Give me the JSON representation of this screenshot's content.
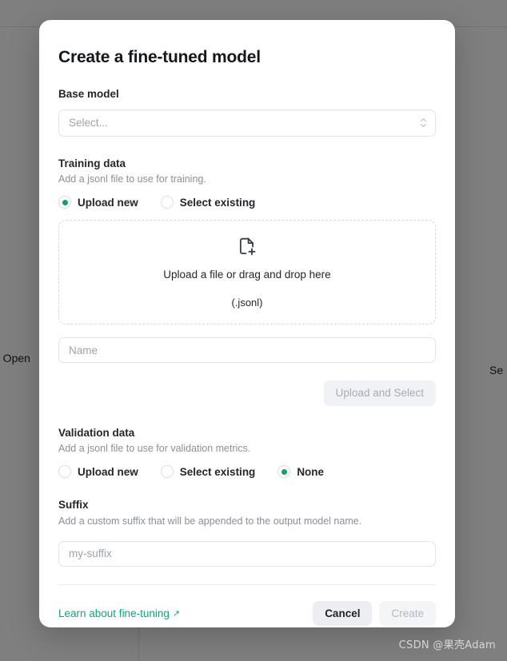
{
  "background": {
    "left_text": "e Open",
    "right_text": "Se"
  },
  "modal": {
    "title": "Create a fine-tuned model",
    "base_model": {
      "label": "Base model",
      "select_placeholder": "Select...",
      "chevron_icon": "chevron-up-down-icon"
    },
    "training_data": {
      "label": "Training data",
      "description": "Add a jsonl file to use for training.",
      "options": [
        {
          "label": "Upload new",
          "selected": true
        },
        {
          "label": "Select existing",
          "selected": false
        }
      ],
      "dropzone": {
        "icon": "file-plus-icon",
        "primary_text": "Upload a file or drag and drop here",
        "secondary_text": "(.jsonl)"
      },
      "name_input": {
        "placeholder": "Name",
        "value": ""
      },
      "upload_button": "Upload and Select"
    },
    "validation_data": {
      "label": "Validation data",
      "description": "Add a jsonl file to use for validation metrics.",
      "options": [
        {
          "label": "Upload new",
          "selected": false
        },
        {
          "label": "Select existing",
          "selected": false
        },
        {
          "label": "None",
          "selected": true
        }
      ]
    },
    "suffix": {
      "label": "Suffix",
      "description": "Add a custom suffix that will be appended to the output model name.",
      "placeholder": "my-suffix",
      "value": ""
    },
    "footer": {
      "learn_link": "Learn about fine-tuning",
      "learn_link_icon": "external-link-arrow-icon",
      "cancel_label": "Cancel",
      "create_label": "Create"
    }
  },
  "watermark": "CSDN @果壳Adam",
  "colors": {
    "accent_green": "#12a06e",
    "link_teal": "#13a37f",
    "text_primary": "#24262b",
    "text_muted": "#9ea2ab"
  }
}
